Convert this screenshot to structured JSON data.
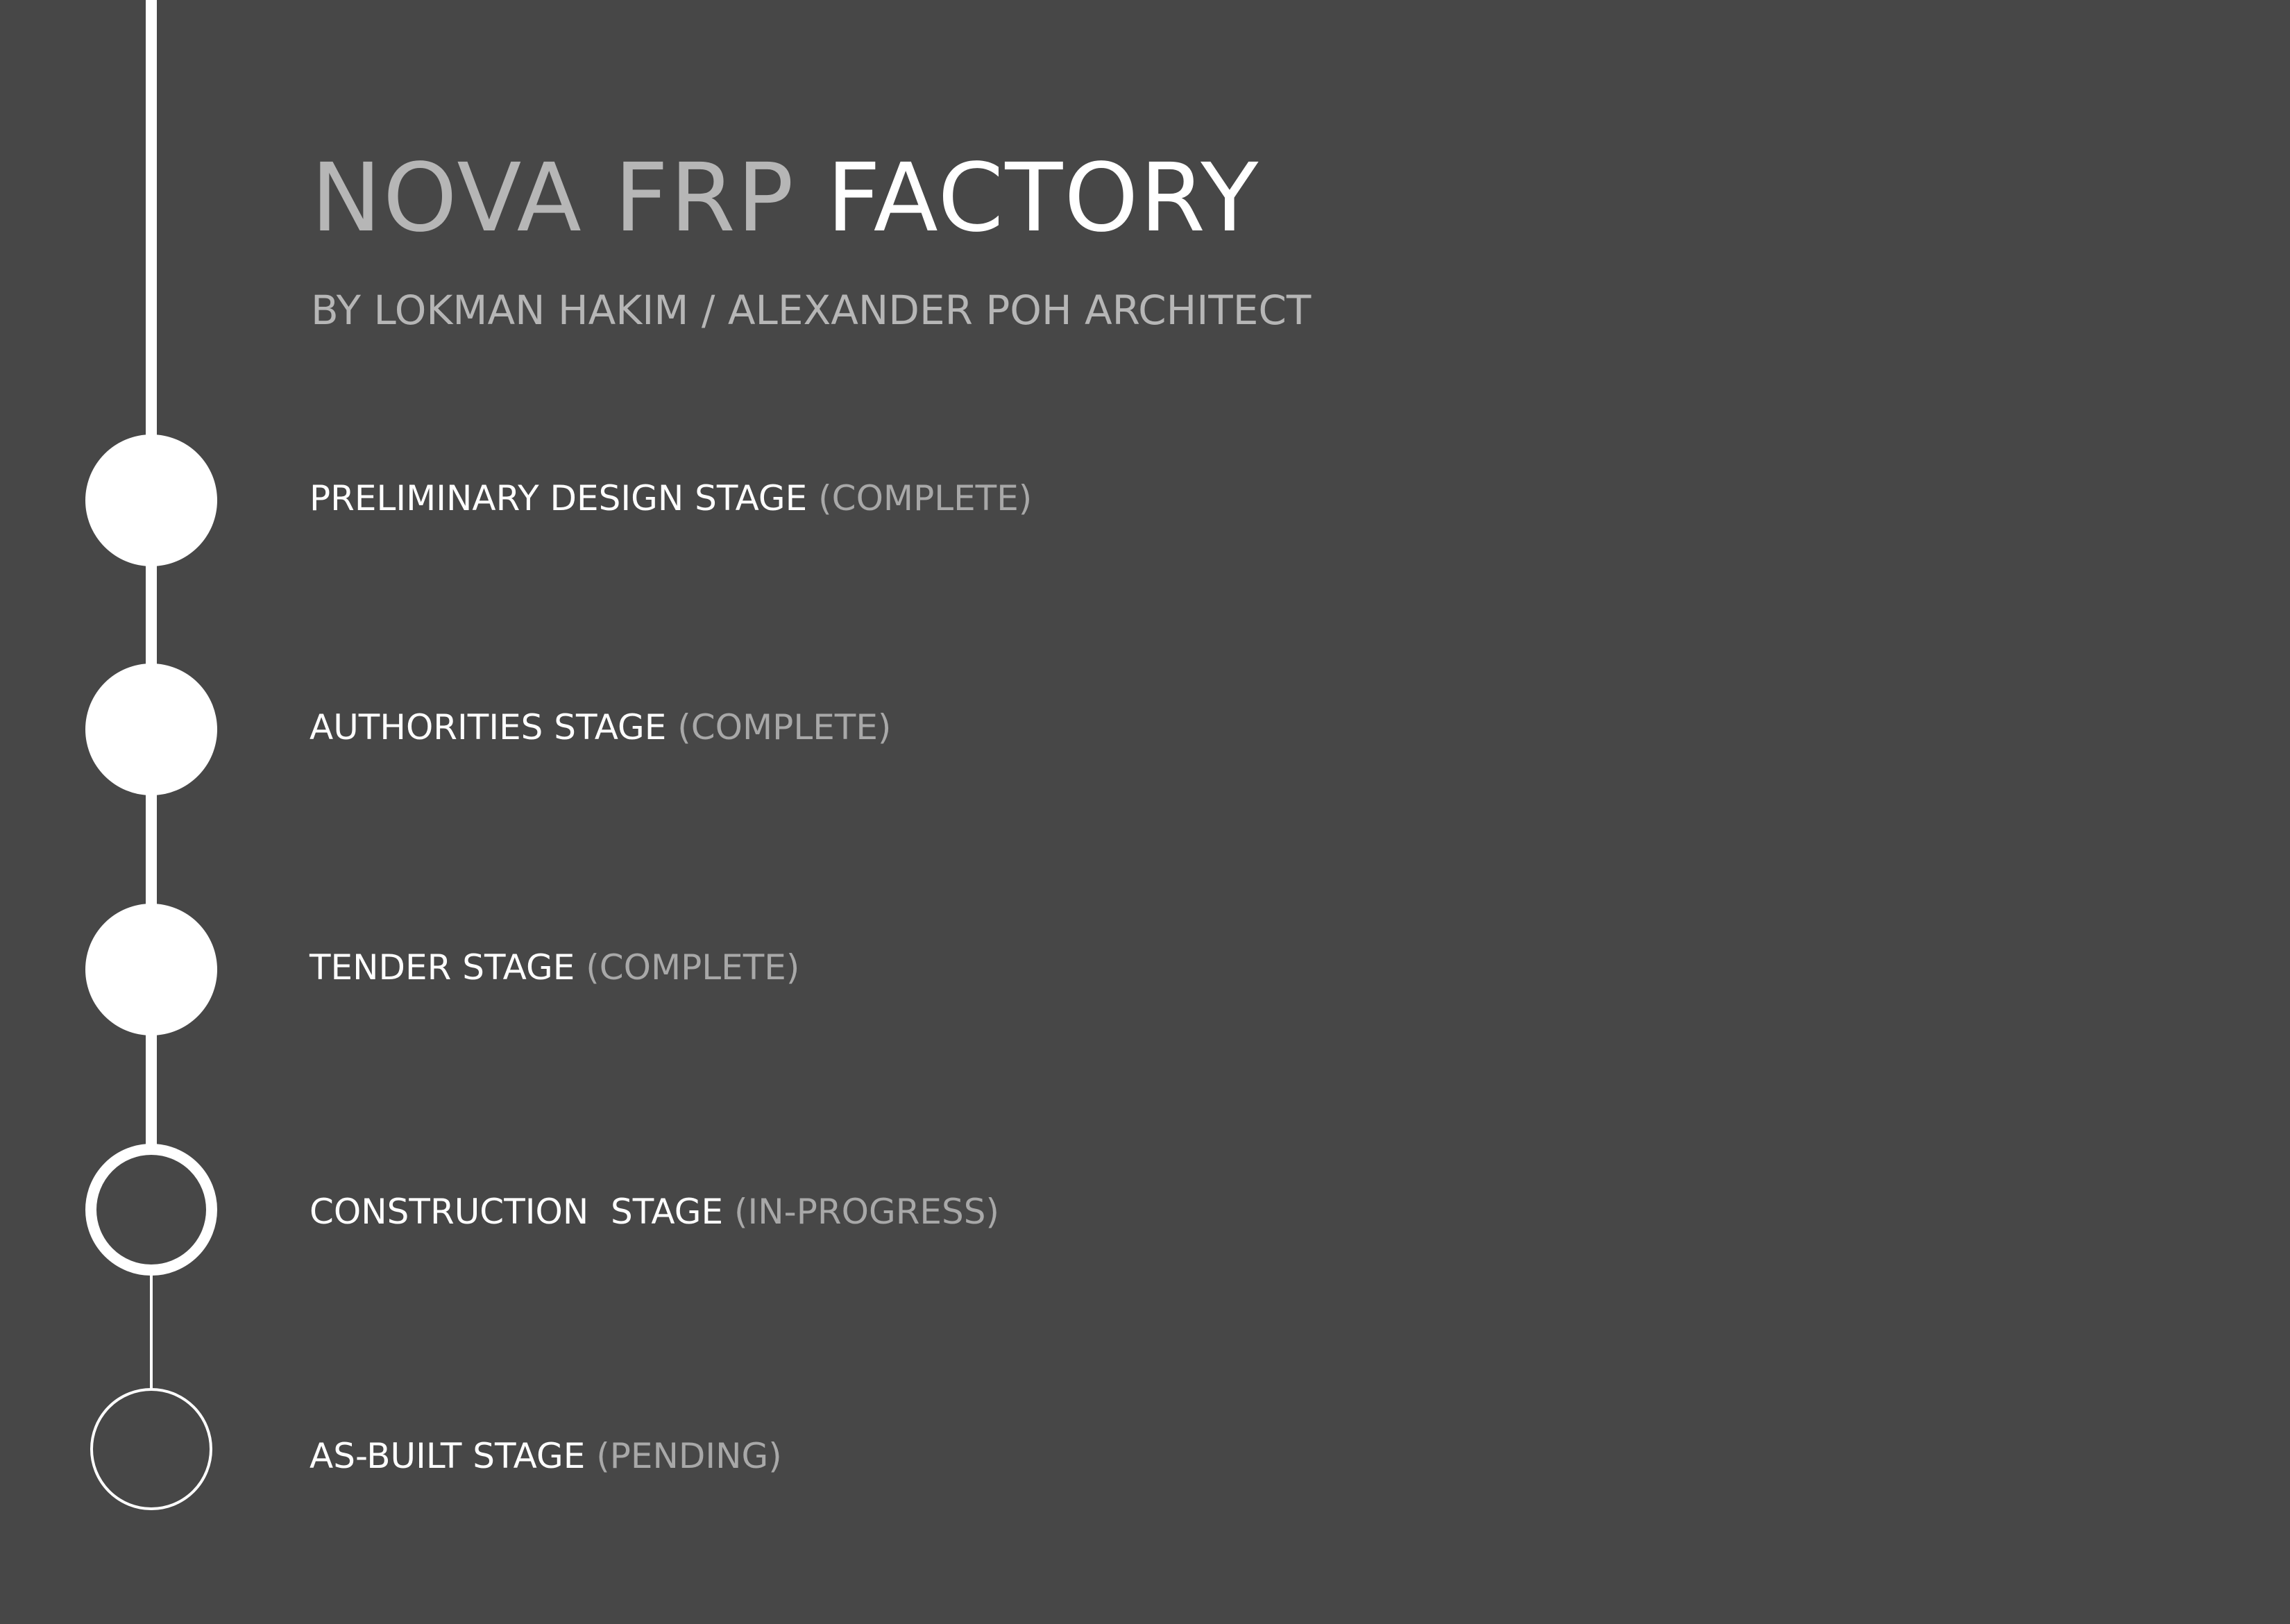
{
  "project": {
    "title_part1": "NOVA FRP",
    "title_part2": "FACTORY",
    "subtitle": "BY LOKMAN HAKIM / ALEXANDER POH ARCHITECT"
  },
  "stages": [
    {
      "name": "PRELIMINARY DESIGN STAGE",
      "status": "(COMPLETE)",
      "state": "complete"
    },
    {
      "name": "AUTHORITIES STAGE",
      "status": "(COMPLETE)",
      "state": "complete"
    },
    {
      "name": "TENDER STAGE",
      "status": "(COMPLETE)",
      "state": "complete"
    },
    {
      "name": "CONSTRUCTION  STAGE",
      "status": "(IN-PROGRESS)",
      "state": "in-progress"
    },
    {
      "name": "AS-BUILT STAGE",
      "status": "(PENDING)",
      "state": "pending"
    }
  ],
  "colors": {
    "background": "#474747",
    "primary_text": "#ffffff",
    "secondary_text": "#b6b6b6",
    "timeline": "#ffffff"
  }
}
